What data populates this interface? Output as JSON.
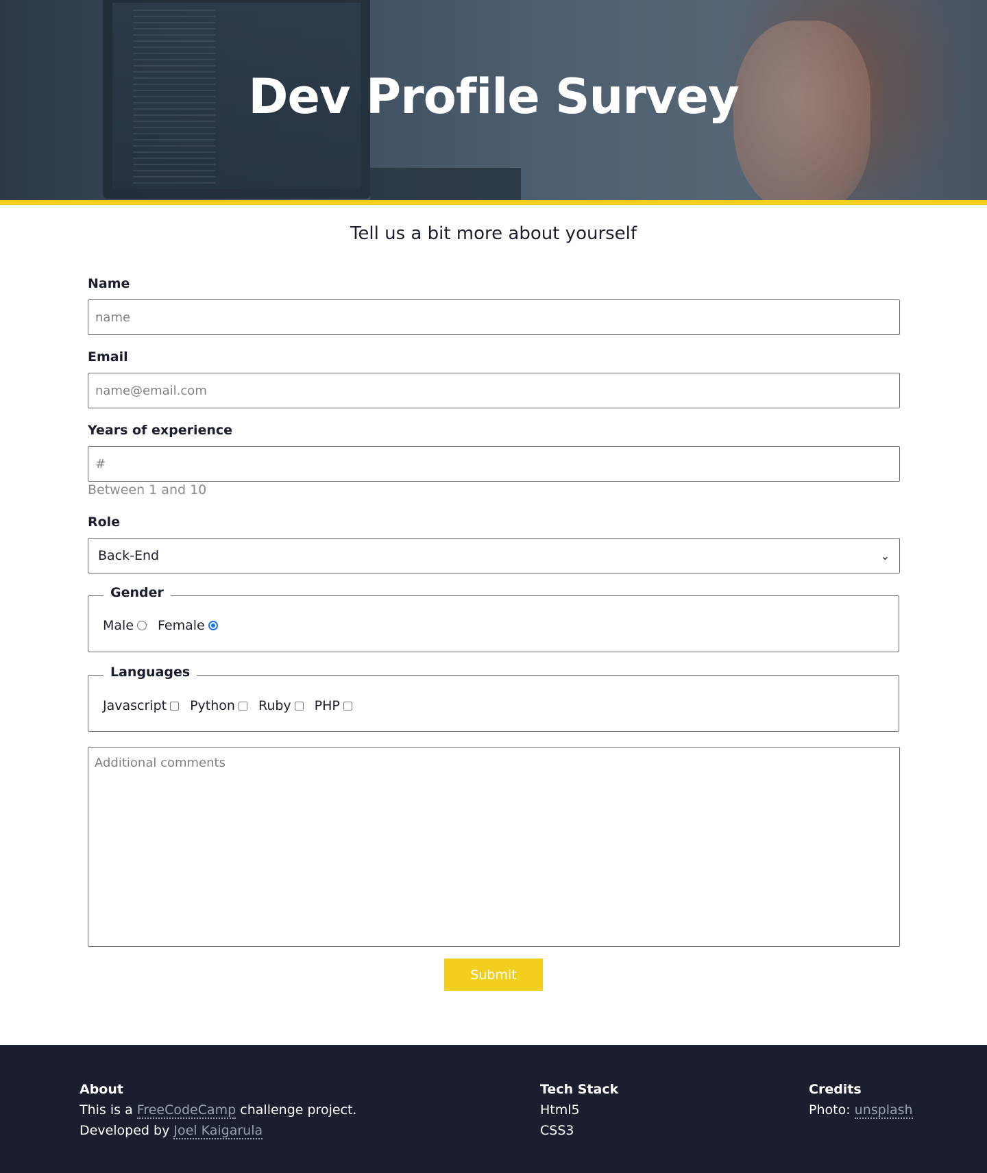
{
  "hero": {
    "title": "Dev Profile Survey"
  },
  "form": {
    "subtitle": "Tell us a bit more about yourself",
    "name": {
      "label": "Name",
      "placeholder": "name"
    },
    "email": {
      "label": "Email",
      "placeholder": "name@email.com"
    },
    "experience": {
      "label": "Years of experience",
      "placeholder": "#",
      "hint": "Between 1 and 10"
    },
    "role": {
      "label": "Role",
      "selected": "Back-End"
    },
    "gender": {
      "legend": "Gender",
      "options": [
        {
          "label": "Male",
          "checked": false
        },
        {
          "label": "Female",
          "checked": true
        }
      ]
    },
    "languages": {
      "legend": "Languages",
      "options": [
        {
          "label": "Javascript",
          "checked": false
        },
        {
          "label": "Python",
          "checked": false
        },
        {
          "label": "Ruby",
          "checked": false
        },
        {
          "label": "PHP",
          "checked": false
        }
      ]
    },
    "comments": {
      "placeholder": "Additional comments"
    },
    "submit_label": "Submit"
  },
  "colors": {
    "accent": "#f2cf1e",
    "footer_bg": "#1b1e2e",
    "link": "#9aa0ad"
  },
  "footer": {
    "about": {
      "heading": "About",
      "line1_prefix": "This is a",
      "line1_link": "FreeCodeCamp",
      "line1_suffix": "challenge project.",
      "line2_prefix": "Developed by",
      "line2_link": "Joel Kaigarula"
    },
    "tech": {
      "heading": "Tech Stack",
      "items": [
        "Html5",
        "CSS3"
      ]
    },
    "credits": {
      "heading": "Credits",
      "prefix": "Photo:",
      "link": "unsplash"
    }
  }
}
